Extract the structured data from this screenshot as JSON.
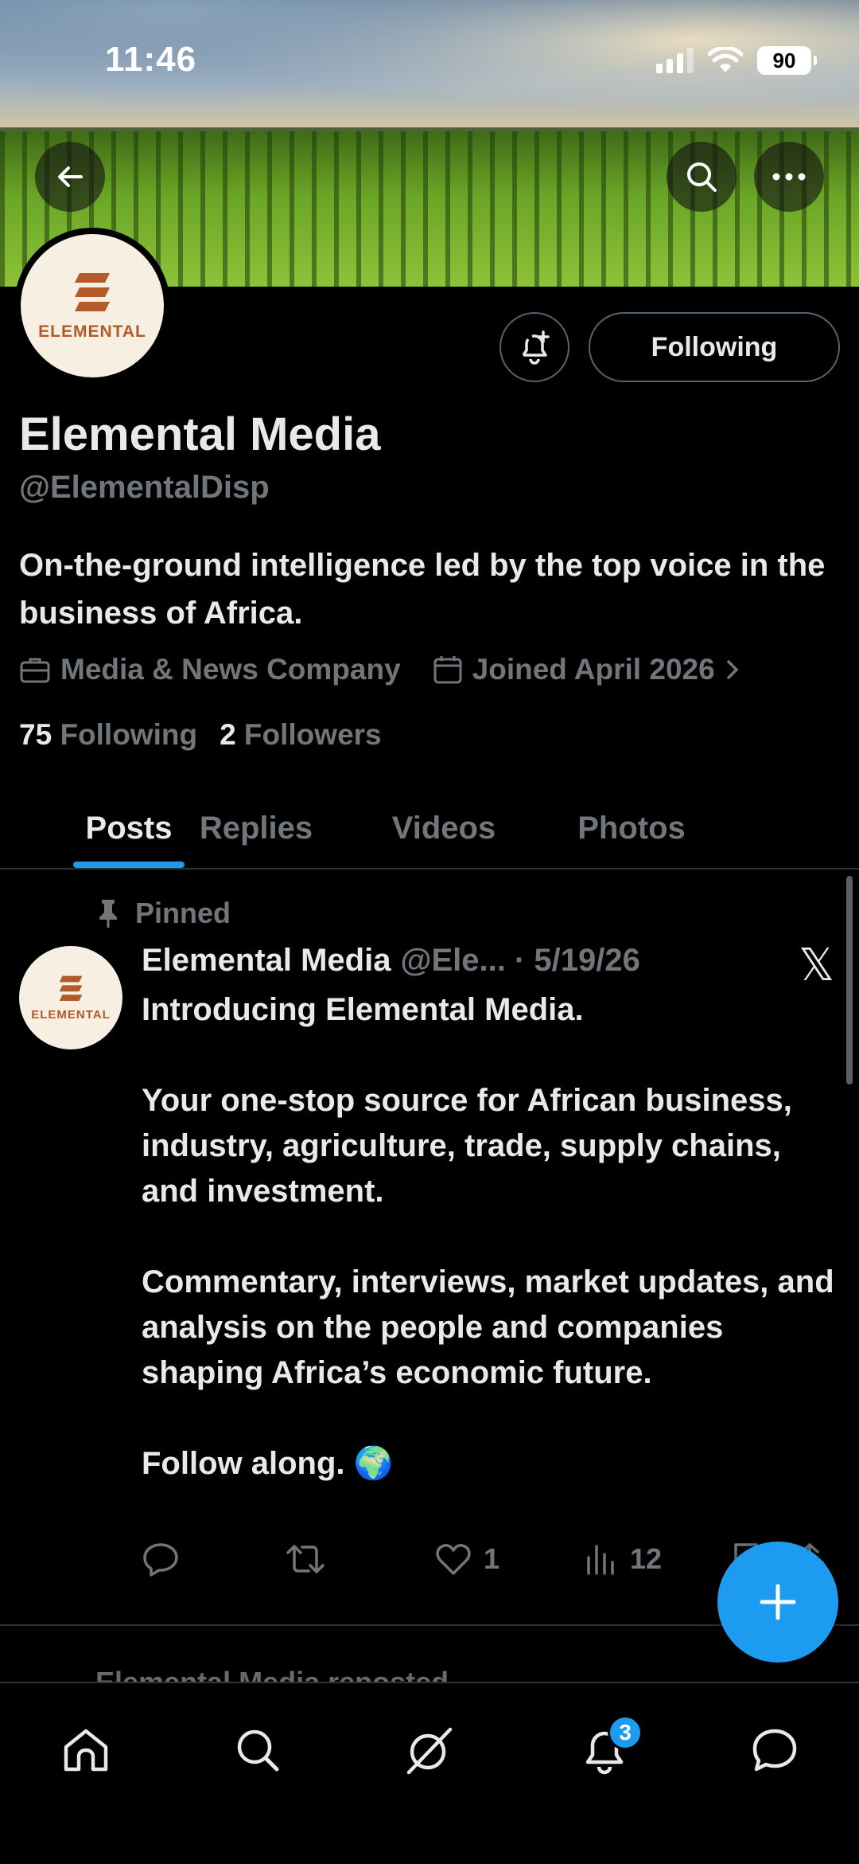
{
  "status_bar": {
    "time": "11:46",
    "battery": "90"
  },
  "header": {
    "back_icon": "arrow-left-icon",
    "search_icon": "search-icon",
    "more_icon": "more-horizontal-icon"
  },
  "profile": {
    "avatar_text": "ELEMENTAL",
    "follow_label": "Following",
    "name": "Elemental Media",
    "handle": "@ElementalDisp",
    "bio": "On-the-ground intelligence led by the top voice in the business of Africa.",
    "category": "Media & News Company",
    "joined": "Joined April 2026",
    "following_count": "75",
    "following_label": "Following",
    "followers_count": "2",
    "followers_label": "Followers"
  },
  "tabs": [
    {
      "label": "Posts"
    },
    {
      "label": "Replies"
    },
    {
      "label": "Videos"
    },
    {
      "label": "Photos"
    }
  ],
  "post": {
    "pinned_label": "Pinned",
    "author": "Elemental Media",
    "handle_date": "@Ele... · 5/19/26",
    "avatar_text": "ELEMENTAL",
    "paragraphs": [
      "Introducing Elemental Media.",
      "Your one-stop source for African business, industry, agriculture, trade, supply chains, and investment.",
      "Commentary, interviews, market updates, and analysis on the people and companies shaping Africa’s economic future.",
      "Follow along. 🌍"
    ],
    "likes": "1",
    "views": "12"
  },
  "next_post_peek": "Elemental Media reposted",
  "nav": {
    "notifications_badge": "3"
  },
  "colors": {
    "accent": "#1d9bf0",
    "muted": "#71767b",
    "border": "#2f3336",
    "brand": "#b25a2a"
  }
}
